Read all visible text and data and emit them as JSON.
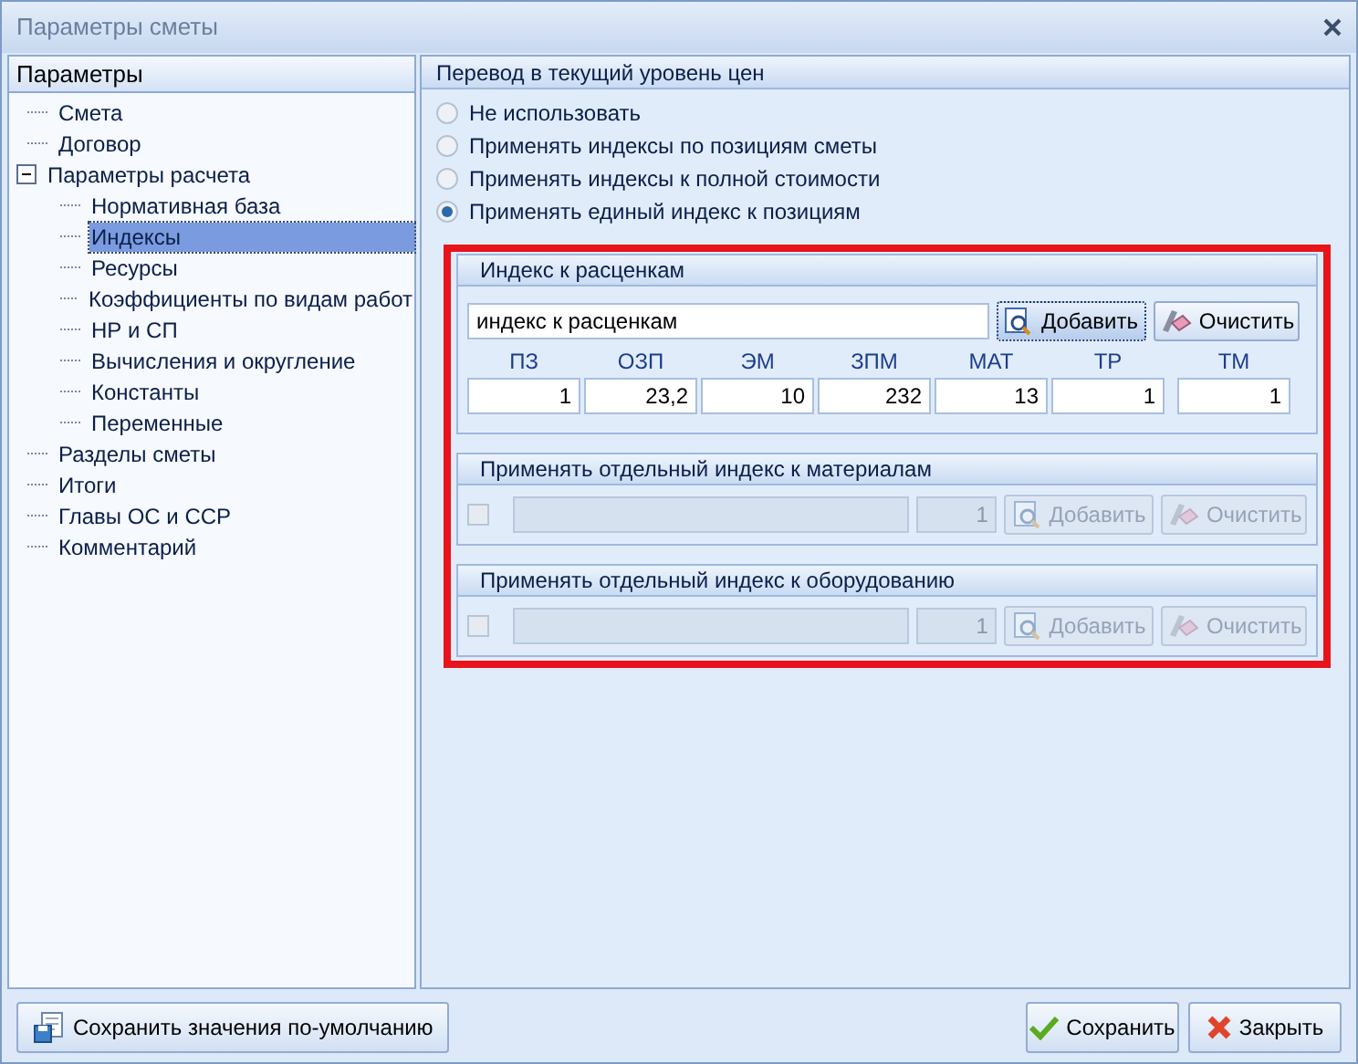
{
  "window": {
    "title": "Параметры сметы"
  },
  "sidebar": {
    "header": "Параметры",
    "items": [
      {
        "label": "Смета",
        "selected": false
      },
      {
        "label": "Договор",
        "selected": false
      },
      {
        "label": "Параметры расчета",
        "selected": false,
        "expanded": true,
        "children": [
          {
            "label": "Нормативная база",
            "selected": false
          },
          {
            "label": "Индексы",
            "selected": true
          },
          {
            "label": "Ресурсы",
            "selected": false
          },
          {
            "label": "Коэффициенты по видам работ",
            "selected": false
          },
          {
            "label": "НР и СП",
            "selected": false
          },
          {
            "label": "Вычисления и округление",
            "selected": false
          },
          {
            "label": "Константы",
            "selected": false
          },
          {
            "label": "Переменные",
            "selected": false
          }
        ]
      },
      {
        "label": "Разделы сметы",
        "selected": false
      },
      {
        "label": "Итоги",
        "selected": false
      },
      {
        "label": "Главы ОС и ССР",
        "selected": false
      },
      {
        "label": "Комментарий",
        "selected": false
      }
    ]
  },
  "panel": {
    "title": "Перевод в текущий уровень цен",
    "options": [
      {
        "label": "Не использовать",
        "selected": false
      },
      {
        "label": "Применять индексы по позициям сметы",
        "selected": false
      },
      {
        "label": "Применять индексы к полной стоимости",
        "selected": false
      },
      {
        "label": "Применять единый индекс к позициям",
        "selected": true
      }
    ]
  },
  "index_group": {
    "title": "Индекс к расценкам",
    "name_value": "индекс к расценкам",
    "add_button": "Добавить",
    "clear_button": "Очистить",
    "fields": [
      {
        "label": "ПЗ",
        "value": "1"
      },
      {
        "label": "ОЗП",
        "value": "23,2"
      },
      {
        "label": "ЭМ",
        "value": "10"
      },
      {
        "label": "ЗПМ",
        "value": "232"
      },
      {
        "label": "МАТ",
        "value": "13"
      },
      {
        "label": "ТР",
        "value": "1"
      },
      {
        "label": "ТМ",
        "value": "1"
      }
    ]
  },
  "separate_groups": [
    {
      "title": "Применять отдельный индекс к материалам",
      "checked": false,
      "disabled": true,
      "value": "1",
      "add_button": "Добавить",
      "clear_button": "Очистить"
    },
    {
      "title": "Применять отдельный индекс к оборудованию",
      "checked": false,
      "disabled": true,
      "value": "1",
      "add_button": "Добавить",
      "clear_button": "Очистить"
    }
  ],
  "buttons": {
    "save_defaults": "Сохранить значения по-умолчанию",
    "save": "Сохранить",
    "close": "Закрыть"
  }
}
